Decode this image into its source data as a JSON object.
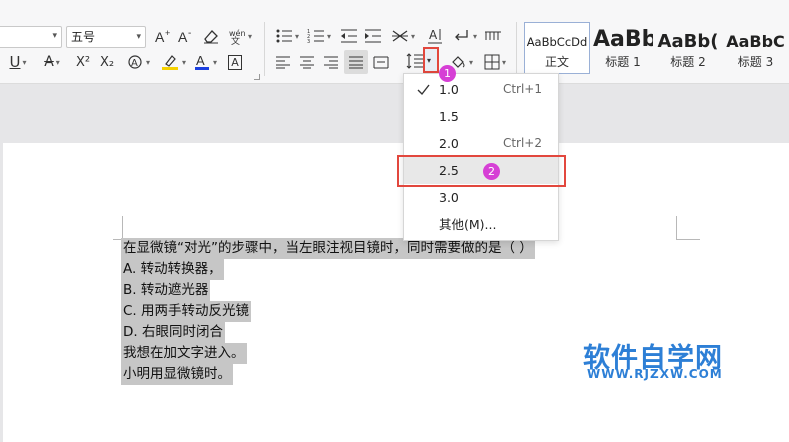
{
  "toolbar": {
    "font_size_value": "五号",
    "strike_label": "A",
    "superscript_label": "X²",
    "subscript_label": "X₂",
    "font_color": "#1a3fe0",
    "highlight_color": "#f5d100",
    "clear_label": "A",
    "char_border_label": "A"
  },
  "styles": {
    "items": [
      {
        "preview": "AaBbCcDd",
        "name": "正文"
      },
      {
        "preview": "AaBb",
        "name": "标题 1"
      },
      {
        "preview": "AaBb(",
        "name": "标题 2"
      },
      {
        "preview": "AaBbC",
        "name": "标题 3"
      }
    ]
  },
  "line_spacing_menu": {
    "items": [
      {
        "label": "1.0",
        "shortcut": "Ctrl+1",
        "checked": true
      },
      {
        "label": "1.5",
        "shortcut": ""
      },
      {
        "label": "2.0",
        "shortcut": "Ctrl+2"
      },
      {
        "label": "2.5",
        "shortcut": ""
      },
      {
        "label": "3.0",
        "shortcut": ""
      },
      {
        "label": "其他(M)...",
        "shortcut": ""
      }
    ]
  },
  "annotations": {
    "badge1": "1",
    "badge2": "2",
    "highlight_color": "#e2473d",
    "badge_color": "#d63fd5"
  },
  "document": {
    "lines": [
      "在显微镜“对光”的步骤中，当左眼注视目镜时，同时需要做的是（   ）",
      "A.  转动转换器，",
      "B.  转动遮光器",
      "C.  用两手转动反光镜",
      "D.  右眼同时闭合",
      "我想在加文字进入。",
      "小明用显微镜时。"
    ]
  },
  "watermark": {
    "title": "软件自学网",
    "url": "WWW.RJZXW.COM"
  }
}
